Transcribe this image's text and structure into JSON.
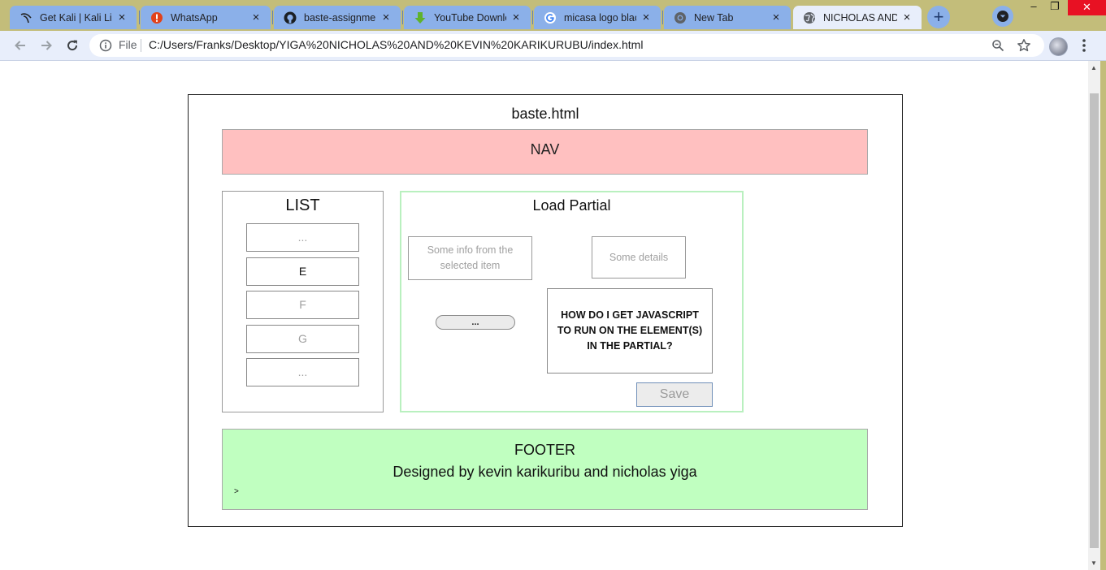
{
  "browser": {
    "tabs": [
      {
        "title": "Get Kali | Kali Linux",
        "icon": "kali-dragon-icon",
        "active": false
      },
      {
        "title": "WhatsApp",
        "icon": "whatsapp-alert-icon",
        "active": false
      },
      {
        "title": "baste-assignment",
        "icon": "github-icon",
        "active": false
      },
      {
        "title": "YouTube Downloader",
        "icon": "download-arrow-icon",
        "active": false
      },
      {
        "title": "micasa logo black",
        "icon": "google-icon",
        "active": false
      },
      {
        "title": "New Tab",
        "icon": "chrome-icon",
        "active": false
      },
      {
        "title": "NICHOLAS AND KEVIN",
        "icon": "globe-icon",
        "active": true
      }
    ],
    "new_tab": "+",
    "close_glyph": "×",
    "window": {
      "minimize": "–",
      "maximize": "❐",
      "close": "✕"
    },
    "address": {
      "scheme_label": "File",
      "url": "C:/Users/Franks/Desktop/YIGA%20NICHOLAS%20AND%20KEVIN%20KARIKURUBU/index.html"
    },
    "colors": {
      "frame": "#c3bd7a",
      "tab": "#8bb0e9",
      "active_tab": "#e8eefb"
    }
  },
  "page": {
    "title": "baste.html",
    "nav": "NAV",
    "list": {
      "title": "LIST",
      "items": [
        {
          "label": "...",
          "selected": false
        },
        {
          "label": "E",
          "selected": true
        },
        {
          "label": "F",
          "selected": false
        },
        {
          "label": "G",
          "selected": false
        },
        {
          "label": "...",
          "selected": false
        }
      ]
    },
    "partial": {
      "title": "Load Partial",
      "info_box": "Some info from the selected item",
      "details_box": "Some details",
      "pill_button": "...",
      "question": "HOW DO I GET JAVASCRIPT TO RUN ON THE ELEMENT(S) IN THE PARTIAL?",
      "save_button": "Save"
    },
    "footer": {
      "title": "FOOTER",
      "credit": "Designed by kevin karikuribu and nicholas yiga",
      "caret": ">"
    },
    "colors": {
      "nav_bg": "#ffc0c0",
      "footer_bg": "#c0ffc0",
      "partial_border": "#b9f0bf"
    }
  }
}
